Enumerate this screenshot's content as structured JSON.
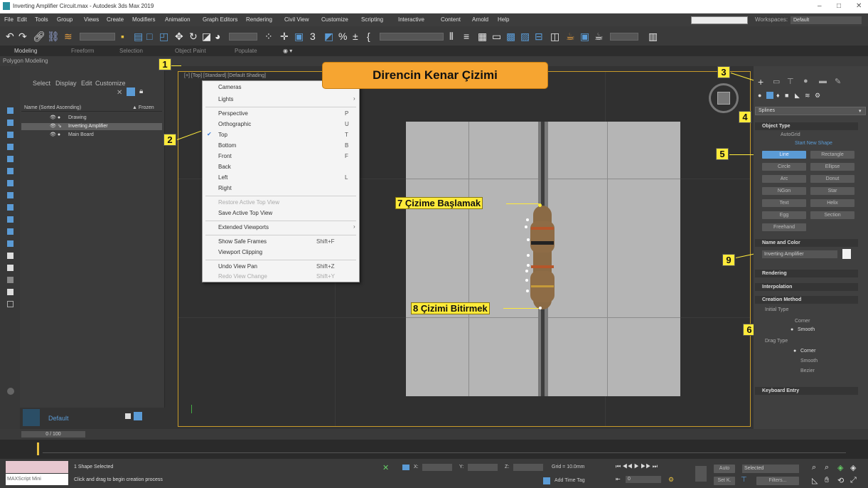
{
  "window": {
    "title": "Inverting Amplifier Circuit.max - Autodesk 3ds Max 2019",
    "minimize": "–",
    "maximize": "□",
    "close": "✕"
  },
  "menu": [
    "File",
    "Edit",
    "Tools",
    "Group",
    "Views",
    "Create",
    "Modifiers",
    "Animation",
    "Graph Editors",
    "Rendering",
    "Civil View",
    "Customize",
    "Scripting",
    "Interactive",
    "Content",
    "Arnold",
    "Help"
  ],
  "workspace": {
    "label": "Workspaces:",
    "value": "Default"
  },
  "ribbon_tabs": [
    "Modeling",
    "Freeform",
    "Selection",
    "Object Paint",
    "Populate"
  ],
  "ribbon_sub": "Polygon Modeling",
  "scene_explorer": {
    "tabs": [
      "Select",
      "Display",
      "Edit",
      "Customize"
    ],
    "col_name": "Name (Sorted Ascending)",
    "col_frozen": "▲ Frozen",
    "rows": [
      "Drawing",
      "Inverting Amplifier",
      "Main Board"
    ]
  },
  "viewport": {
    "label": "[+] [Top] [Standard] [Default Shading]"
  },
  "context_menu": {
    "items": [
      {
        "label": "Cameras",
        "shortcut": "›"
      },
      {
        "label": "Lights",
        "shortcut": "›"
      },
      {
        "label": "Perspective",
        "shortcut": "P"
      },
      {
        "label": "Orthographic",
        "shortcut": "U"
      },
      {
        "label": "Top",
        "shortcut": "T",
        "checked": "✔"
      },
      {
        "label": "Bottom",
        "shortcut": "B"
      },
      {
        "label": "Front",
        "shortcut": "F"
      },
      {
        "label": "Back",
        "shortcut": ""
      },
      {
        "label": "Left",
        "shortcut": "L"
      },
      {
        "label": "Right",
        "shortcut": ""
      },
      {
        "label": "Restore Active Top View",
        "shortcut": ""
      },
      {
        "label": "Save Active Top View",
        "shortcut": ""
      },
      {
        "label": "Extended Viewports",
        "shortcut": "›"
      },
      {
        "label": "Show Safe Frames",
        "shortcut": "Shift+F"
      },
      {
        "label": "Viewport Clipping",
        "shortcut": ""
      },
      {
        "label": "Undo View Pan",
        "shortcut": "Shift+Z"
      },
      {
        "label": "Redo View Change",
        "shortcut": "Shift+Y"
      }
    ]
  },
  "callouts": {
    "title": "Direncin Kenar Çizimi",
    "start": "7 Çizime Başlamak",
    "end": "8 Çizimi Bitirmek",
    "n1": "1",
    "n2": "2",
    "n3": "3",
    "n4": "4",
    "n5": "5",
    "n6": "6",
    "n9": "9"
  },
  "command_panel": {
    "category": "Splines",
    "object_type": "Object Type",
    "autogrid": "AutoGrid",
    "start_new_shape": "Start New Shape",
    "buttons": [
      "Line",
      "Rectangle",
      "Circle",
      "Ellipse",
      "Arc",
      "Donut",
      "NGon",
      "Star",
      "Text",
      "Helix",
      "Egg",
      "Section",
      "Freehand"
    ],
    "name_color": "Name and Color",
    "name_value": "Inverting Amplifier",
    "rendering": "Rendering",
    "interpolation": "Interpolation",
    "creation_method": "Creation Method",
    "initial_type": "Initial Type",
    "initial_opts": [
      "Corner",
      "Smooth"
    ],
    "drag_type": "Drag Type",
    "drag_opts": [
      "Corner",
      "Smooth",
      "Bezier"
    ],
    "keyboard_entry": "Keyboard Entry"
  },
  "timeline": {
    "frame": "0 / 100"
  },
  "status": {
    "selected": "1 Shape Selected",
    "prompt": "Click and drag to begin creation process",
    "maxscript": "MAXScript Mini",
    "x_label": "X:",
    "y_label": "Y:",
    "z_label": "Z:",
    "grid": "Grid = 10.0mm",
    "add_time_tag": "Add Time Tag",
    "auto": "Auto",
    "selected_dd": "Selected",
    "set_k": "Set K.",
    "filters": "Filters...",
    "layer": "Default",
    "frame_field": "0"
  },
  "colors": {
    "accent": "#ffeb3b",
    "frame": "#c89b2a",
    "active_btn": "#5b9bd5",
    "resistor": "#8a6a45"
  }
}
